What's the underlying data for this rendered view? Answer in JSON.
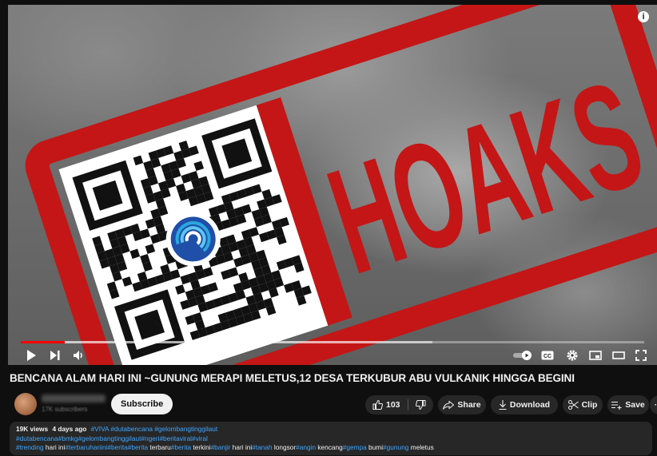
{
  "video": {
    "stamp_text": "HOAKS",
    "info_icon": "i",
    "progress_played_fraction": 0.07,
    "progress_loaded_fraction": 0.66
  },
  "controls": {
    "icons": [
      "play-icon",
      "next-icon",
      "volume-icon",
      "autoplay-toggle-icon",
      "subtitles-icon",
      "settings-icon",
      "miniplayer-icon",
      "theater-icon",
      "fullscreen-icon"
    ],
    "cc_label": "CC"
  },
  "title": "BENCANA ALAM HARI INI ~GUNUNG MERAPI MELETUS,12 DESA TERKUBUR ABU VULKANIK HINGGA BEGINI",
  "channel": {
    "subscribe_label": "Subscribe",
    "subscribers_text": "17K subscribers"
  },
  "actions": {
    "like_count": "103",
    "share_label": "Share",
    "download_label": "Download",
    "clip_label": "Clip",
    "save_label": "Save",
    "more_label": "···"
  },
  "description": {
    "views": "19K views",
    "age": "4 days ago",
    "top_tags": "#VIVA #dutabencana #gelombangtinggilaut",
    "line2": "#dutabencana#bmkg#gelombangtinggilaut#ngeri#beritaviral#viral",
    "line3": [
      {
        "t": "#trending",
        "tag": true
      },
      {
        "t": " hari ini",
        "tag": false
      },
      {
        "t": "#terbaruhariini",
        "tag": true
      },
      {
        "t": "#berita",
        "tag": true
      },
      {
        "t": "#berita",
        "tag": true
      },
      {
        "t": " terbaru",
        "tag": false
      },
      {
        "t": "#berita",
        "tag": true
      },
      {
        "t": " terkini",
        "tag": false
      },
      {
        "t": "#banjir",
        "tag": true
      },
      {
        "t": " hari ini",
        "tag": false
      },
      {
        "t": "#tanah",
        "tag": true
      },
      {
        "t": " longsor",
        "tag": false
      },
      {
        "t": "#angin",
        "tag": true
      },
      {
        "t": " kencang",
        "tag": false
      },
      {
        "t": "#gempa",
        "tag": true
      },
      {
        "t": " bumi",
        "tag": false
      },
      {
        "t": "#gunung",
        "tag": true
      },
      {
        "t": " meletus",
        "tag": false
      }
    ]
  },
  "colors": {
    "stamp_red": "#c41616",
    "progress_red": "#ff0000",
    "link_blue": "#3ea6ff",
    "background": "#0f0f0f",
    "pill_bg": "#272727"
  }
}
